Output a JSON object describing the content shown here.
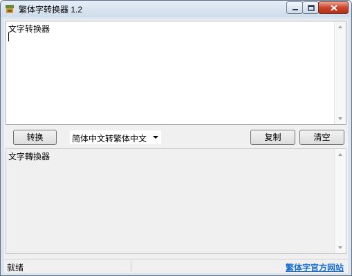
{
  "window": {
    "title": "繁体字转换器 1.2",
    "accent": "#dbe5f0",
    "close_color": "#c9452b"
  },
  "input": {
    "value": "文字转换器"
  },
  "toolbar": {
    "convert_label": "转换",
    "mode_select": "简体中文转繁体中文",
    "copy_label": "复制",
    "clear_label": "清空"
  },
  "output": {
    "value": "文字轉換器"
  },
  "status": {
    "text": "就绪",
    "link_text": "繁体字官方网站",
    "link_color": "#1a6fd1"
  },
  "icons": [
    "app-icon",
    "minimize-icon",
    "maximize-icon",
    "close-icon",
    "scroll-up-icon",
    "scroll-down-icon",
    "dropdown-arrow-icon"
  ]
}
